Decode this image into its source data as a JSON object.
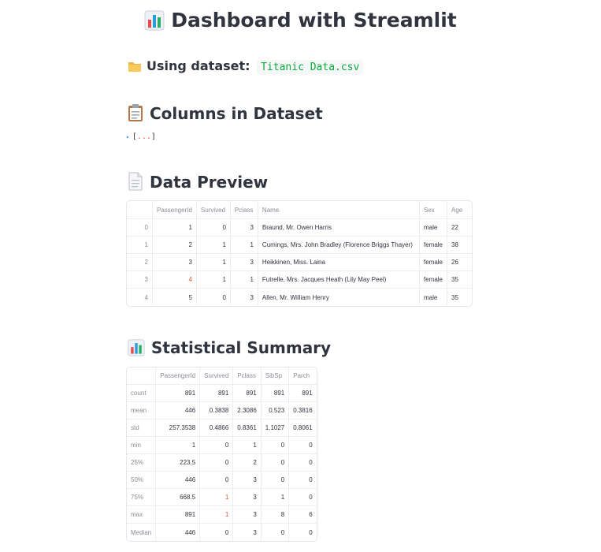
{
  "title": "Dashboard with Streamlit",
  "dataset": {
    "label": "Using dataset:",
    "file": "Titanic Data.csv"
  },
  "columns_section": {
    "heading": "Columns in Dataset",
    "toggle_open": "[",
    "toggle_dots": "...",
    "toggle_close": "]"
  },
  "preview": {
    "heading": "Data Preview",
    "headers": [
      "",
      "PassengerId",
      "Survived",
      "Pclass",
      "Name",
      "Sex",
      "Age"
    ],
    "rows": [
      [
        "0",
        "1",
        "0",
        "3",
        "Braund, Mr. Owen Harris",
        "male",
        "22"
      ],
      [
        "1",
        "2",
        "1",
        "1",
        "Cumings, Mrs. John Bradley (Florence Briggs Thayer)",
        "female",
        "38"
      ],
      [
        "2",
        "3",
        "1",
        "3",
        "Heikkinen, Miss. Laina",
        "female",
        "26"
      ],
      [
        "3",
        "4",
        "1",
        "1",
        "Futrelle, Mrs. Jacques Heath (Lily May Peel)",
        "female",
        "35"
      ],
      [
        "4",
        "5",
        "0",
        "3",
        "Allen, Mr. William Henry",
        "male",
        "35"
      ]
    ]
  },
  "summary": {
    "heading": "Statistical Summary",
    "headers": [
      "",
      "PassengerId",
      "Survived",
      "Pclass",
      "SibSp",
      "Parch"
    ],
    "rows": [
      [
        "count",
        "891",
        "891",
        "891",
        "891",
        "891"
      ],
      [
        "mean",
        "446",
        "0.3838",
        "2.3086",
        "0.523",
        "0.3816"
      ],
      [
        "std",
        "257.3538",
        "0.4866",
        "0.8361",
        "1.1027",
        "0.8061"
      ],
      [
        "min",
        "1",
        "0",
        "1",
        "0",
        "0"
      ],
      [
        "25%",
        "223.5",
        "0",
        "2",
        "0",
        "0"
      ],
      [
        "50%",
        "446",
        "0",
        "3",
        "0",
        "0"
      ],
      [
        "75%",
        "668.5",
        "1",
        "3",
        "1",
        "0"
      ],
      [
        "max",
        "891",
        "1",
        "3",
        "8",
        "6"
      ],
      [
        "Median",
        "446",
        "0",
        "3",
        "0",
        "0"
      ]
    ]
  },
  "colors": {
    "text": "#31333f",
    "code_green": "#09ab3b",
    "accent_red": "#e0533b",
    "border": "#e6e6ea"
  },
  "icons": {
    "title": "bar-chart-icon",
    "dataset": "folder-icon",
    "columns": "clipboard-icon",
    "preview": "document-icon",
    "summary": "bar-chart-icon"
  }
}
